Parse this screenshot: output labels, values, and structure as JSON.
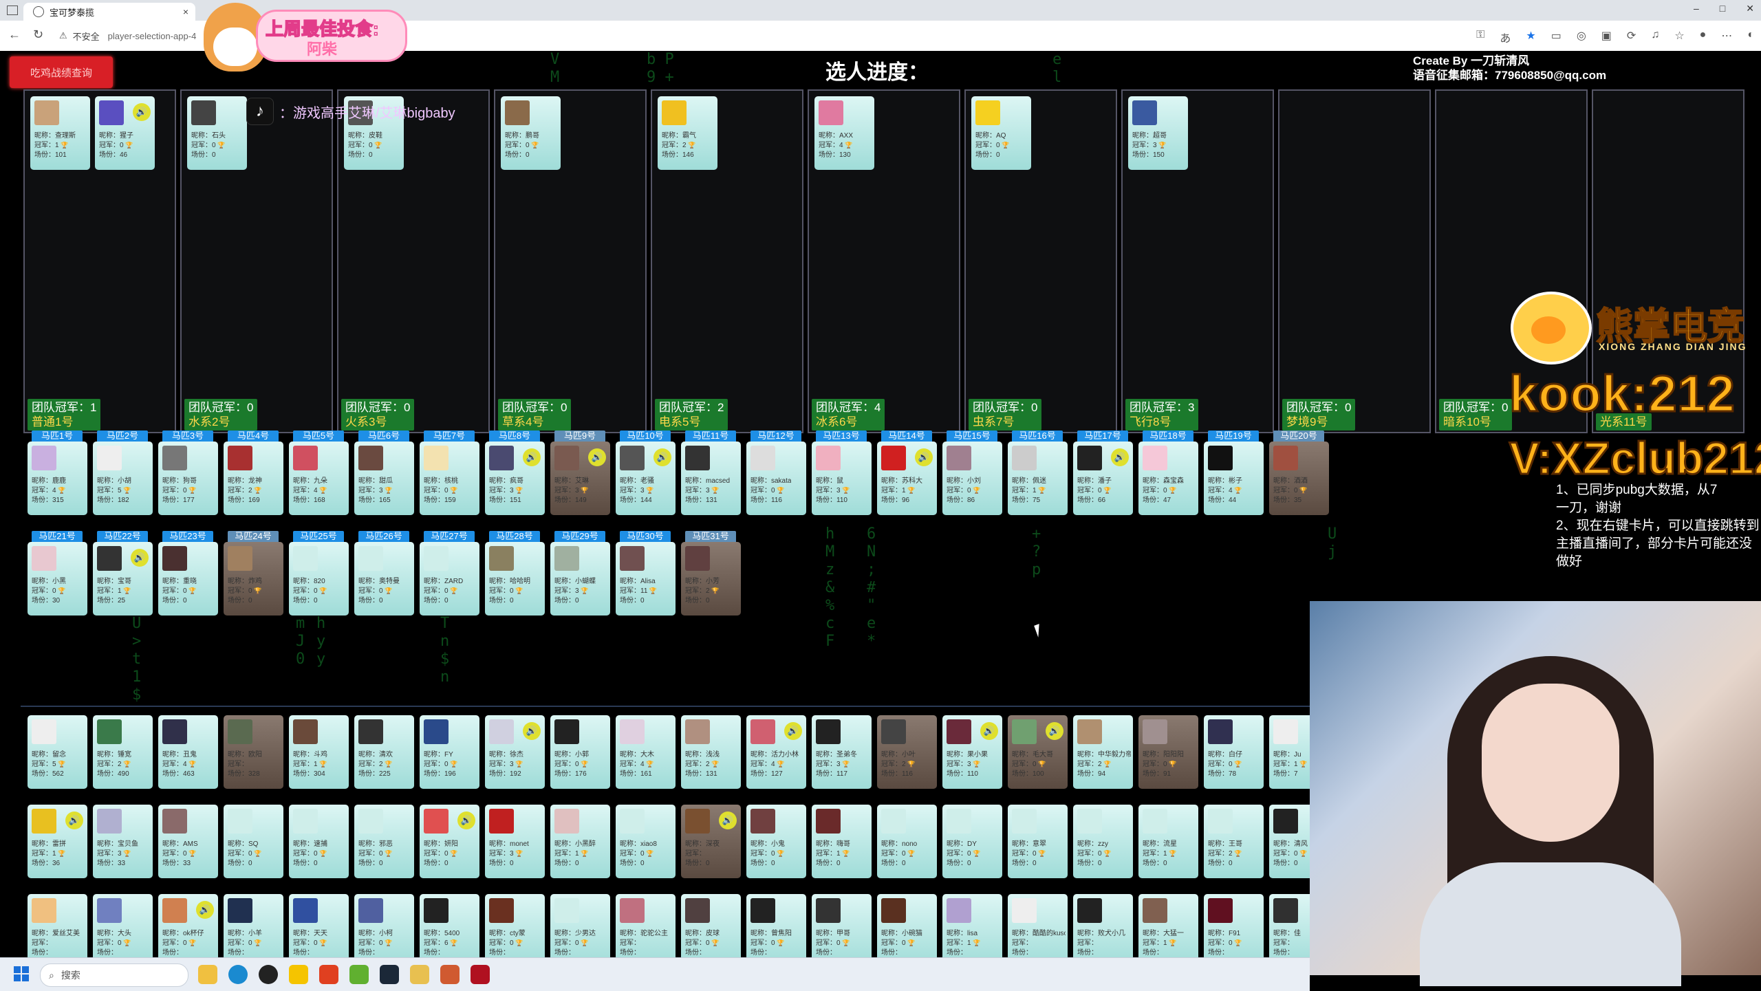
{
  "browser": {
    "tab_title": "宝可梦泰揽",
    "tab_close": "×",
    "window_controls": [
      "–",
      "□",
      "✕"
    ],
    "security_label": "不安全",
    "url": "player-selection-app-4"
  },
  "header": {
    "query_button": "吃鸡战绩查询",
    "progress_title": "选人进度：",
    "credits_line1": "Create By 一刀斩清风",
    "credits_line2": "语音征集邮箱：779608850@qq.com"
  },
  "overlay": {
    "banner_title": "上周最佳投食:",
    "banner_name": "阿柴",
    "tiktok_text": "：游戏高手艾琳/艾琳bigbaby",
    "brand_name": "熊掌电竞",
    "brand_pinyin": "XIONG ZHANG DIAN JING",
    "kook": "kook:212",
    "vx": "V:XZclub212",
    "notes": [
      "1、已同步pubg大数据，从7",
      "一刀，谢谢",
      "2、现在右键卡片，可以直接跳转到主播直播间了，部分卡片可能还没做好"
    ]
  },
  "teams": [
    {
      "name": "普通1号",
      "wins": "团队冠军：1",
      "players": [
        {
          "nick": "查理斯",
          "wins": "1",
          "games": "101",
          "color": "#c9a27a"
        },
        {
          "nick": "猩子",
          "wins": "0",
          "games": "46",
          "color": "#5a4fc0",
          "voice": true
        }
      ]
    },
    {
      "name": "水系2号",
      "wins": "团队冠军：0",
      "players": [
        {
          "nick": "石头",
          "wins": "0",
          "games": "0",
          "color": "#444"
        }
      ]
    },
    {
      "name": "火系3号",
      "wins": "团队冠军：0",
      "players": [
        {
          "nick": "皮鞋",
          "wins": "0",
          "games": "0",
          "color": "#555"
        }
      ]
    },
    {
      "name": "草系4号",
      "wins": "团队冠军：0",
      "players": [
        {
          "nick": "鹏哥",
          "wins": "0",
          "games": "0",
          "color": "#8a6a4a"
        }
      ]
    },
    {
      "name": "电系5号",
      "wins": "团队冠军：2",
      "players": [
        {
          "nick": "霸气",
          "wins": "2",
          "games": "146",
          "color": "#f0c020"
        }
      ]
    },
    {
      "name": "冰系6号",
      "wins": "团队冠军：4",
      "players": [
        {
          "nick": "AXX",
          "wins": "4",
          "games": "130",
          "color": "#e07aa0"
        }
      ]
    },
    {
      "name": "虫系7号",
      "wins": "团队冠军：0",
      "players": [
        {
          "nick": "AQ",
          "wins": "0",
          "games": "0",
          "color": "#f5d020"
        }
      ]
    },
    {
      "name": "飞行8号",
      "wins": "团队冠军：3",
      "players": [
        {
          "nick": "超哥",
          "wins": "3",
          "games": "150",
          "color": "#3a5aa0"
        }
      ]
    },
    {
      "name": "梦境9号",
      "wins": "团队冠军：0",
      "players": []
    },
    {
      "name": "暗系10号",
      "wins": "团队冠军：0",
      "players": []
    },
    {
      "name": "光系11号",
      "wins": "",
      "players": []
    }
  ],
  "horses_row1": [
    {
      "label": "马匹1号",
      "nick": "鹿鹿",
      "wins": "4",
      "games": "315",
      "color": "#c9b0e0"
    },
    {
      "label": "马匹2号",
      "nick": "小胡",
      "wins": "5",
      "games": "182",
      "color": "#eee"
    },
    {
      "label": "马匹3号",
      "nick": "狗哥",
      "wins": "0",
      "games": "177",
      "color": "#777"
    },
    {
      "label": "马匹4号",
      "nick": "龙神",
      "wins": "2",
      "games": "169",
      "color": "#a83030"
    },
    {
      "label": "马匹5号",
      "nick": "九朵",
      "wins": "4",
      "games": "168",
      "color": "#d05060"
    },
    {
      "label": "马匹6号",
      "nick": "甜瓜",
      "wins": "3",
      "games": "165",
      "color": "#6a4a40"
    },
    {
      "label": "马匹7号",
      "nick": "核桃",
      "wins": "0",
      "games": "159",
      "color": "#f3e2b0"
    },
    {
      "label": "马匹8号",
      "nick": "疯哥",
      "wins": "3",
      "games": "151",
      "color": "#4a4a70",
      "voice": true
    },
    {
      "label": "马匹9号",
      "nick": "艾琳",
      "wins": "3",
      "games": "149",
      "color": "#7a5a50",
      "voice": true,
      "dim": true
    },
    {
      "label": "马匹10号",
      "nick": "老骚",
      "wins": "3",
      "games": "144",
      "color": "#555",
      "voice": true
    },
    {
      "label": "马匹11号",
      "nick": "macsed",
      "wins": "3",
      "games": "131",
      "color": "#333"
    },
    {
      "label": "马匹12号",
      "nick": "sakata",
      "wins": "0",
      "games": "116",
      "color": "#ddd"
    },
    {
      "label": "马匹13号",
      "nick": "鼠",
      "wins": "3",
      "games": "110",
      "color": "#f0b0c0"
    },
    {
      "label": "马匹14号",
      "nick": "苏科大",
      "wins": "1",
      "games": "96",
      "color": "#d02020",
      "voice": true
    },
    {
      "label": "马匹15号",
      "nick": "小刘",
      "wins": "0",
      "games": "86",
      "color": "#a08090"
    },
    {
      "label": "马匹16号",
      "nick": "佩迷",
      "wins": "1",
      "games": "75",
      "color": "#ccc"
    },
    {
      "label": "马匹17号",
      "nick": "潘子",
      "wins": "0",
      "games": "66",
      "color": "#222",
      "voice": true
    },
    {
      "label": "马匹18号",
      "nick": "森宝森",
      "wins": "0",
      "games": "47",
      "color": "#f5c8d8"
    },
    {
      "label": "马匹19号",
      "nick": "彬子",
      "wins": "4",
      "games": "44",
      "color": "#111"
    },
    {
      "label": "马匹20号",
      "nick": "酒酒",
      "wins": "0",
      "games": "35",
      "color": "#a05040",
      "dim": true
    }
  ],
  "horses_row2": [
    {
      "label": "马匹21号",
      "nick": "小黑",
      "wins": "0",
      "games": "30",
      "color": "#e8c8d0"
    },
    {
      "label": "马匹22号",
      "nick": "宝哥",
      "wins": "1",
      "games": "25",
      "color": "#333",
      "voice": true
    },
    {
      "label": "马匹23号",
      "nick": "重晓",
      "wins": "0",
      "games": "0",
      "color": "#4a3030"
    },
    {
      "label": "马匹24号",
      "nick": "炸鸡",
      "wins": "0",
      "games": "0",
      "color": "#a08060",
      "dim": true
    },
    {
      "label": "马匹25号",
      "nick": "820",
      "wins": "0",
      "games": "0",
      "color": "#cfeeea"
    },
    {
      "label": "马匹26号",
      "nick": "奥特曼",
      "wins": "0",
      "games": "0",
      "color": "#cfeeea"
    },
    {
      "label": "马匹27号",
      "nick": "ZARD",
      "wins": "0",
      "games": "0",
      "color": "#cfeeea"
    },
    {
      "label": "马匹28号",
      "nick": "哈哈明",
      "wins": "0",
      "games": "0",
      "color": "#8a8060"
    },
    {
      "label": "马匹29号",
      "nick": "小蝴蝶",
      "wins": "3",
      "games": "0",
      "color": "#a0b0a0"
    },
    {
      "label": "马匹30号",
      "nick": "Alisa",
      "wins": "11",
      "games": "0",
      "color": "#705050"
    },
    {
      "label": "马匹31号",
      "nick": "小芳",
      "wins": "2",
      "games": "0",
      "color": "#604040",
      "dim": true
    }
  ],
  "pool_row1": [
    {
      "nick": "留念",
      "wins": "5",
      "games": "562",
      "color": "#eee"
    },
    {
      "nick": "锤宽",
      "wins": "2",
      "games": "490",
      "color": "#3a7a4a"
    },
    {
      "nick": "丑鬼",
      "wins": "4",
      "games": "463",
      "color": "#30304a"
    },
    {
      "nick": "欧阳",
      "wins": "",
      "games": "328",
      "color": "#5a6a50",
      "dim": true
    },
    {
      "nick": "斗鸡",
      "wins": "1",
      "games": "304",
      "color": "#6a4a3a"
    },
    {
      "nick": "清欢",
      "wins": "2",
      "games": "225",
      "color": "#333"
    },
    {
      "nick": "FY",
      "wins": "0",
      "games": "196",
      "color": "#2a4a8a"
    },
    {
      "nick": "徐杰",
      "wins": "3",
      "games": "192",
      "color": "#d0d0e0",
      "voice": true
    },
    {
      "nick": "小郭",
      "wins": "0",
      "games": "176",
      "color": "#222"
    },
    {
      "nick": "大木",
      "wins": "4",
      "games": "161",
      "color": "#e0d0e0"
    },
    {
      "nick": "浅浅",
      "wins": "2",
      "games": "131",
      "color": "#b09080"
    },
    {
      "nick": "活力小林",
      "wins": "4",
      "games": "127",
      "color": "#d06070",
      "voice": true
    },
    {
      "nick": "圣弟冬",
      "wins": "3",
      "games": "117",
      "color": "#222"
    },
    {
      "nick": "小叶",
      "wins": "2",
      "games": "116",
      "color": "#444",
      "dim": true
    },
    {
      "nick": "果小果",
      "wins": "3",
      "games": "110",
      "color": "#6a2a3a",
      "voice": true
    },
    {
      "nick": "毛大哥",
      "wins": "0",
      "games": "100",
      "color": "#70a070",
      "voice": true,
      "dim": true
    },
    {
      "nick": "中华毅力帝",
      "wins": "2",
      "games": "94",
      "color": "#b09070"
    },
    {
      "nick": "阳阳阳",
      "wins": "0",
      "games": "91",
      "color": "#a09090",
      "dim": true
    },
    {
      "nick": "白仔",
      "wins": "0",
      "games": "78",
      "color": "#303050"
    },
    {
      "nick": "Ju",
      "wins": "1",
      "games": "7",
      "color": "#eee"
    }
  ],
  "pool_row2": [
    {
      "nick": "雷拼",
      "wins": "1",
      "games": "36",
      "color": "#e8c020",
      "voice": true
    },
    {
      "nick": "宝贝鱼",
      "wins": "3",
      "games": "33",
      "color": "#b0b0d0"
    },
    {
      "nick": "AMS",
      "wins": "0",
      "games": "33",
      "color": "#8a6a6a"
    },
    {
      "nick": "SQ",
      "wins": "0",
      "games": "0",
      "color": "#cfeeea"
    },
    {
      "nick": "速捕",
      "wins": "0",
      "games": "0",
      "color": "#cfeeea"
    },
    {
      "nick": "邪恶",
      "wins": "0",
      "games": "0",
      "color": "#cfeeea"
    },
    {
      "nick": "妍阳",
      "wins": "0",
      "games": "0",
      "color": "#e05050",
      "voice": true
    },
    {
      "nick": "monet",
      "wins": "3",
      "games": "0",
      "color": "#c02020"
    },
    {
      "nick": "小黑醉",
      "wins": "1",
      "games": "0",
      "color": "#e0c0c0"
    },
    {
      "nick": "xiao8",
      "wins": "0",
      "games": "0",
      "color": "#cfeeea"
    },
    {
      "nick": "深夜",
      "wins": "",
      "games": "0",
      "color": "#7a5030",
      "voice": true,
      "dim": true
    },
    {
      "nick": "小鬼",
      "wins": "0",
      "games": "0",
      "color": "#704040"
    },
    {
      "nick": "嗨哥",
      "wins": "1",
      "games": "0",
      "color": "#6a2a2a"
    },
    {
      "nick": "nono",
      "wins": "0",
      "games": "0",
      "color": "#cfeeea"
    },
    {
      "nick": "DY",
      "wins": "0",
      "games": "0",
      "color": "#cfeeea"
    },
    {
      "nick": "意翠",
      "wins": "0",
      "games": "0",
      "color": "#cfeeea"
    },
    {
      "nick": "zzy",
      "wins": "0",
      "games": "0",
      "color": "#cfeeea"
    },
    {
      "nick": "流星",
      "wins": "1",
      "games": "0",
      "color": "#cfeeea"
    },
    {
      "nick": "王哥",
      "wins": "2",
      "games": "0",
      "color": "#cfeeea"
    },
    {
      "nick": "清风",
      "wins": "0",
      "games": "0",
      "color": "#222"
    }
  ],
  "pool_row3": [
    {
      "nick": "爱丝艾美",
      "wins": "",
      "games": "",
      "color": "#f0c080"
    },
    {
      "nick": "大头",
      "wins": "0",
      "games": "",
      "color": "#7080c0"
    },
    {
      "nick": "ok杯仔",
      "wins": "0",
      "games": "",
      "color": "#d08050",
      "voice": true
    },
    {
      "nick": "小羊",
      "wins": "0",
      "games": "",
      "color": "#203050"
    },
    {
      "nick": "天天",
      "wins": "0",
      "games": "",
      "color": "#3050a0"
    },
    {
      "nick": "小柯",
      "wins": "0",
      "games": "",
      "color": "#5060a0"
    },
    {
      "nick": "5400",
      "wins": "6",
      "games": "",
      "color": "#222"
    },
    {
      "nick": "cty蒙",
      "wins": "0",
      "games": "",
      "color": "#6a3020"
    },
    {
      "nick": "少男达",
      "wins": "0",
      "games": "",
      "color": "#cfeeea"
    },
    {
      "nick": "驼驼公主",
      "wins": "",
      "games": "",
      "color": "#c07080"
    },
    {
      "nick": "皮球",
      "wins": "0",
      "games": "",
      "color": "#504040"
    },
    {
      "nick": "曾焦阳",
      "wins": "0",
      "games": "",
      "color": "#222"
    },
    {
      "nick": "甲哥",
      "wins": "0",
      "games": "",
      "color": "#333"
    },
    {
      "nick": "小碗猫",
      "wins": "0",
      "games": "",
      "color": "#5a3020"
    },
    {
      "nick": "lisa",
      "wins": "1",
      "games": "",
      "color": "#b0a0d0"
    },
    {
      "nick": "酷酷的kusoo",
      "wins": "",
      "games": "",
      "color": "#eee"
    },
    {
      "nick": "败犬小几",
      "wins": "",
      "games": "",
      "color": "#222"
    },
    {
      "nick": "大猛一",
      "wins": "1",
      "games": "",
      "color": "#806050"
    },
    {
      "nick": "F91",
      "wins": "0",
      "games": "",
      "color": "#601020"
    },
    {
      "nick": "佳",
      "wins": "",
      "games": "",
      "color": "#303030"
    }
  ],
  "labels": {
    "nick_prefix": "昵称：",
    "wins_prefix": "冠军：",
    "games_prefix": "场份："
  },
  "taskbar": {
    "search_placeholder": "搜索"
  }
}
